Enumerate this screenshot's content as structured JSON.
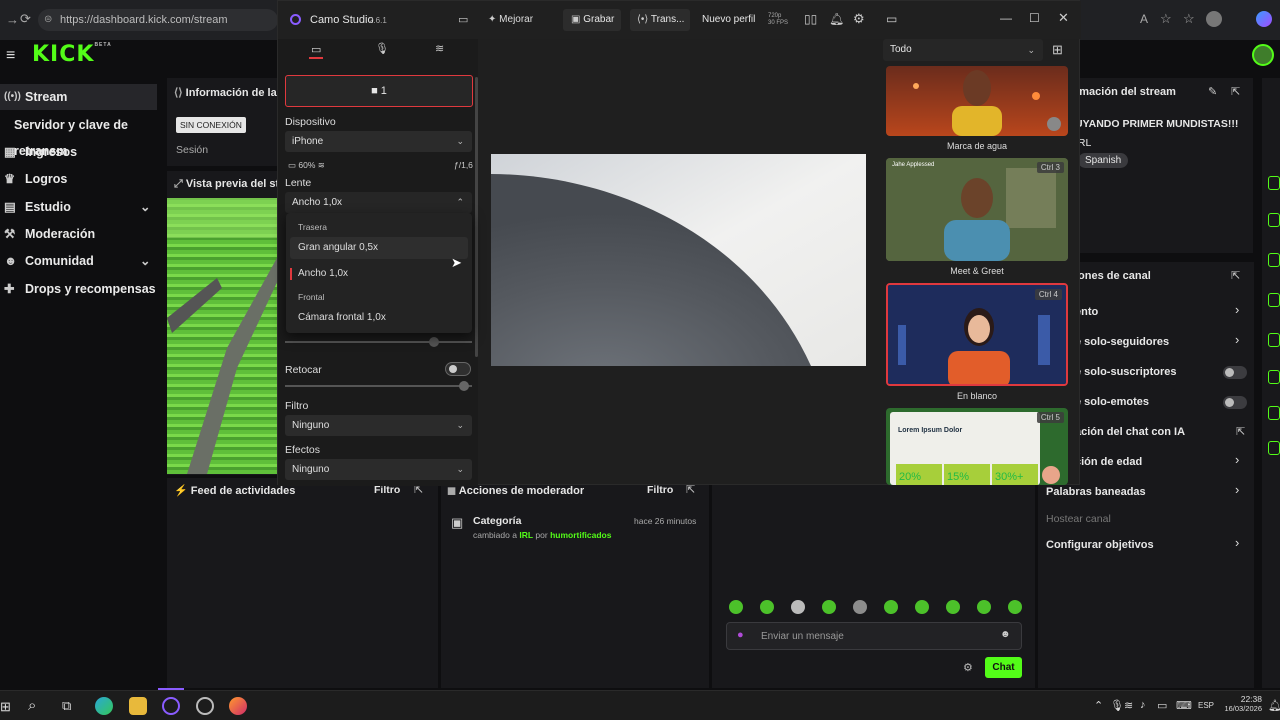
{
  "browser": {
    "url": "https://dashboard.kick.com/stream"
  },
  "kick": {
    "logo": "KICK",
    "logo_badge": "BETA",
    "sidebar": [
      {
        "label": "Stream",
        "icon": "stream-icon"
      },
      {
        "label": "Servidor y clave de retransm"
      },
      {
        "label": "Ingresos",
        "icon": "income-icon"
      },
      {
        "label": "Logros",
        "icon": "trophy-icon"
      },
      {
        "label": "Estudio",
        "icon": "studio-icon"
      },
      {
        "label": "Moderación",
        "icon": "moderation-icon"
      },
      {
        "label": "Comunidad",
        "icon": "community-icon"
      },
      {
        "label": "Drops y recompensas",
        "icon": "gift-icon"
      }
    ],
    "stream_info": {
      "title": "Información de la s",
      "status": "SIN CONEXIÓN",
      "session": "Sesión"
    },
    "preview_title": "Vista previa del str",
    "feed": {
      "title": "Feed de actividades",
      "filter": "Filtro"
    },
    "mod_actions": {
      "title": "Acciones de moderador",
      "filter": "Filtro",
      "entry": {
        "title": "Categoría",
        "time": "hace 26 minutos",
        "prefix": "cambiado a",
        "value": "IRL",
        "by": "por",
        "user": "humortificados"
      }
    },
    "chat": {
      "placeholder": "Enviar un mensaje",
      "send": "Chat"
    },
    "right_panel": {
      "title": "rmación del stream",
      "stream_title": "UYANDO PRIMER MUNDISTAS!!!",
      "category": "IRL",
      "language": "Spanish",
      "channel_title": "iones de canal",
      "items": [
        {
          "label": "ento",
          "type": "chev"
        },
        {
          "label": "e solo-seguidores",
          "type": "chev"
        },
        {
          "label": "e solo-suscriptores",
          "type": "toggle"
        },
        {
          "label": "e solo-emotes",
          "type": "toggle"
        },
        {
          "label": "ación del chat con IA",
          "type": "ext"
        },
        {
          "label": "ción de edad",
          "type": "chev"
        }
      ],
      "banned_words": "Palabras baneadas",
      "host": "Hostear canal",
      "goals": "Configurar objetivos"
    }
  },
  "camo": {
    "title": "Camo Studio",
    "version": "2.6.1",
    "toolbar": {
      "mejorar": "Mejorar",
      "grabar": "Grabar",
      "trans": "Trans...",
      "profile": "Nuevo perfil",
      "res": "720p",
      "fps": "30 FPS"
    },
    "source_button": "1",
    "device_label": "Dispositivo",
    "device": "iPhone",
    "battery": "60%",
    "aperture": "ƒ/1,6",
    "lens_label": "Lente",
    "lens": "Ancho 1,0x",
    "dropdown": {
      "group1": "Trasera",
      "opt1": "Gran angular 0,5x",
      "opt2": "Ancho 1,0x",
      "group2": "Frontal",
      "opt3": "Cámara frontal 1,0x"
    },
    "retouch_label": "Retocar",
    "filter_label": "Filtro",
    "filter": "Ninguno",
    "effects_label": "Efectos",
    "effects": "Ninguno",
    "scene_filter": "Todo",
    "scenes": [
      {
        "label": "Marca de agua",
        "ctrl": ""
      },
      {
        "label": "Meet & Greet",
        "ctrl": "Ctrl 3",
        "overlay_name": "Jahe Applessed"
      },
      {
        "label": "En blanco",
        "ctrl": "Ctrl 4"
      },
      {
        "label": "",
        "ctrl": "Ctrl 5",
        "doc_title": "Lorem Ipsum Dolor",
        "stats": [
          "20%",
          "15%",
          "30%+"
        ]
      }
    ]
  },
  "taskbar": {
    "lang": "ESP",
    "time": "22:38",
    "date": "16/03/2026"
  }
}
